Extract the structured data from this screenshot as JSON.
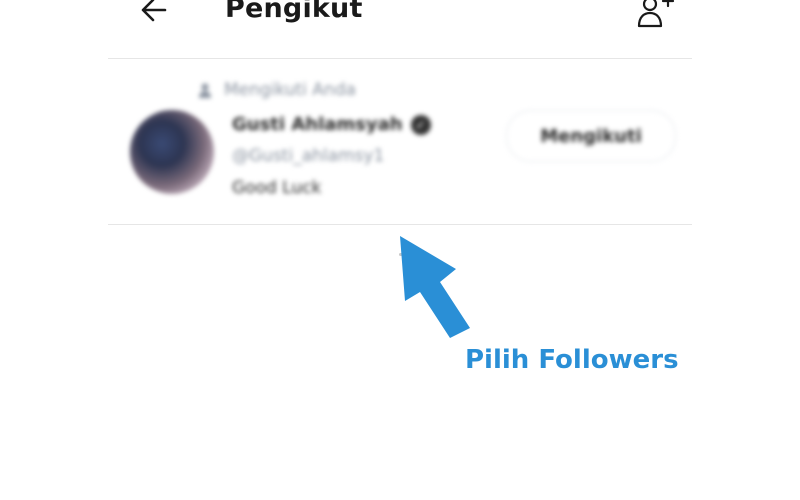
{
  "header": {
    "title": "Pengikut",
    "back_icon": "arrow-left-icon",
    "add_user_icon": "person-add-icon"
  },
  "follower": {
    "follow_note": "Mengikuti Anda",
    "name": "Gusti Ahlamsyah",
    "handle": "@Gusti_ahlamsy1",
    "bio": "Good Luck",
    "button_label": "Mengikuti",
    "verified_icon": "verified-badge-icon"
  },
  "annotation": {
    "label": "Pilih Followers",
    "color": "#2a8fd6"
  },
  "colors": {
    "divider": "#e6e6e6",
    "muted_text": "#8a93a0",
    "annotation_blue": "#2a8fd6"
  }
}
